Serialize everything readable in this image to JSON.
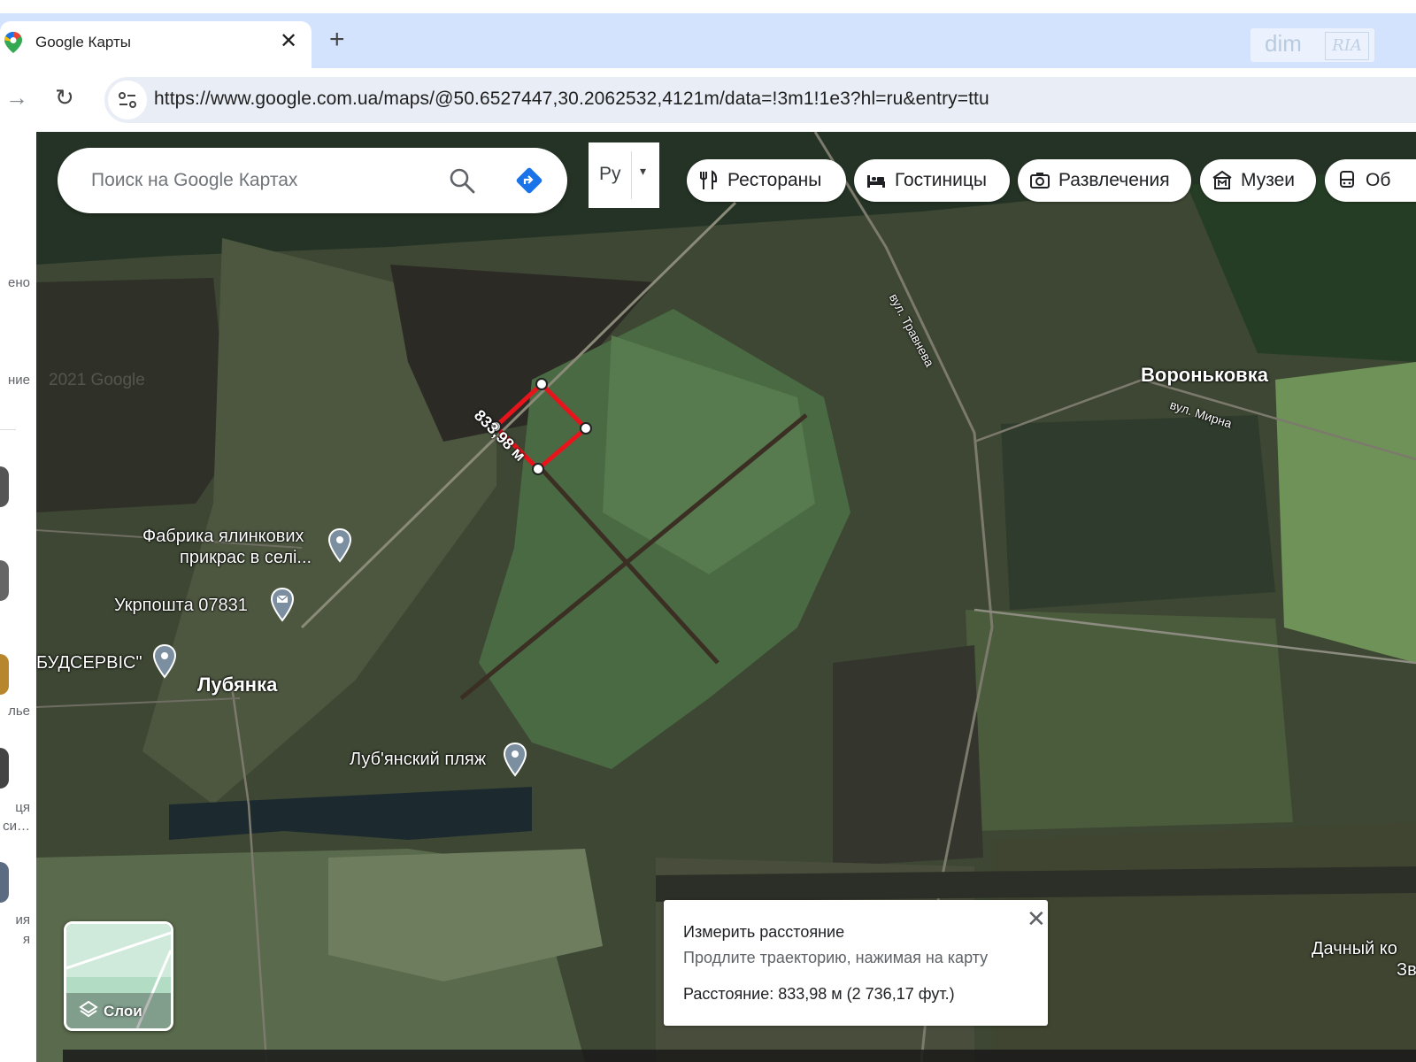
{
  "browser": {
    "tab_title": "Google Карты",
    "close_glyph": "✕",
    "new_tab_glyph": "+",
    "forward_glyph": "→",
    "reload_glyph": "↻",
    "url": "https://www.google.com.ua/maps/@50.6527447,30.2062532,4121m/data=!3m1!1e3?hl=ru&entry=ttu"
  },
  "watermark": {
    "text": "dim",
    "badge": "RIA"
  },
  "side_panel": {
    "labels": [
      "ено",
      "ние",
      "",
      "",
      "лье",
      "ця",
      "си…",
      "ия",
      "я"
    ]
  },
  "search": {
    "placeholder": "Поиск на Google Картах"
  },
  "language": {
    "label": "Ру",
    "caret": "▾"
  },
  "chips": [
    {
      "label": "Рестораны",
      "icon": "fork-knife-icon"
    },
    {
      "label": "Гостиницы",
      "icon": "bed-icon"
    },
    {
      "label": "Развлечения",
      "icon": "camera-icon"
    },
    {
      "label": "Музеи",
      "icon": "museum-icon"
    },
    {
      "label": "Об",
      "icon": "train-icon"
    }
  ],
  "map_labels": {
    "street_tr": "вул. Травнева",
    "street_mir": "вул. Мирна",
    "village_vor": "Вороньковка",
    "village_lub": "Лубянка",
    "poi_factory_1": "Фабрика ялинкових",
    "poi_factory_2": "прикрас в селі...",
    "poi_post": "Укрпошта 07831",
    "poi_bud": "БУДСЕРВІС\"",
    "poi_beach": "Луб'янский пляж",
    "dacha_1": "Дачный ко",
    "dacha_2": "Зв",
    "measure_on_map": "833,98 м",
    "copyright_faint": "2021 Google"
  },
  "layers": {
    "label": "Слои"
  },
  "measure": {
    "title": "Измерить расстояние",
    "hint": "Продлите траекторию, нажимая на карту",
    "distance": "Расстояние: 833,98 м (2 736,17 фут.)",
    "close_glyph": "✕"
  },
  "colors": {
    "tab_strip": "#d3e3fd",
    "omnibox": "#e9eef6",
    "measure_path": "#e8141c",
    "directions_blue": "#1a73e8"
  }
}
